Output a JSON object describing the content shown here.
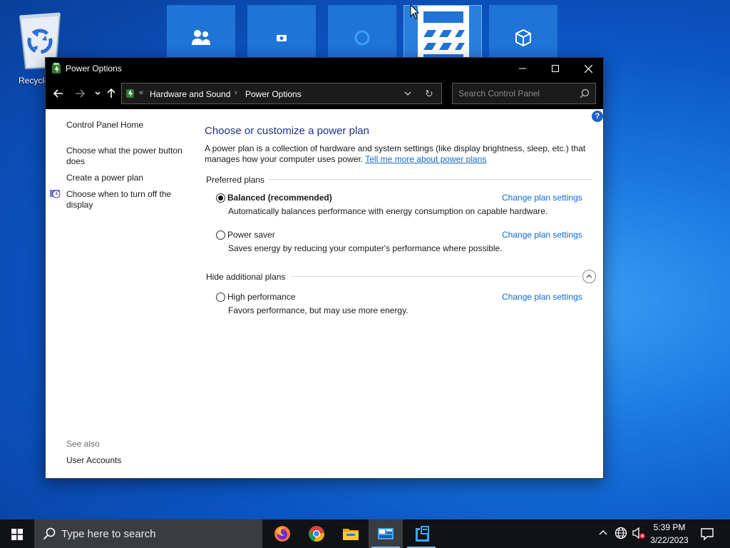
{
  "desktop": {
    "recycle_bin_label": "Recycle Bin"
  },
  "window": {
    "title": "Power Options",
    "breadcrumb": [
      "Hardware and Sound",
      "Power Options"
    ],
    "search_placeholder": "Search Control Panel"
  },
  "sidebar": {
    "home": "Control Panel Home",
    "power_button": "Choose what the power button does",
    "create_plan": "Create a power plan",
    "turn_off_display": "Choose when to turn off the display",
    "see_also": "See also",
    "user_accounts": "User Accounts"
  },
  "main": {
    "title": "Choose or customize a power plan",
    "description": "A power plan is a collection of hardware and system settings (like display brightness, sleep, etc.) that manages how your computer uses power.",
    "learn_more": "Tell me more about power plans",
    "preferred_header": "Preferred plans",
    "additional_header": "Hide additional plans",
    "plans": [
      {
        "name": "Balanced (recommended)",
        "description": "Automatically balances performance with energy consumption on capable hardware.",
        "link": "Change plan settings",
        "selected": true
      },
      {
        "name": "Power saver",
        "description": "Saves energy by reducing your computer's performance where possible.",
        "link": "Change plan settings",
        "selected": false
      },
      {
        "name": "High performance",
        "description": "Favors performance, but may use more energy.",
        "link": "Change plan settings",
        "selected": false
      }
    ]
  },
  "taskbar": {
    "search_placeholder": "Type here to search",
    "time": "5:39 PM",
    "date": "3/22/2023"
  },
  "colors": {
    "title_blue": "#1e3287",
    "link_blue": "#0b6ad0",
    "chrome_black": "#000000",
    "taskbar": "#101216"
  }
}
